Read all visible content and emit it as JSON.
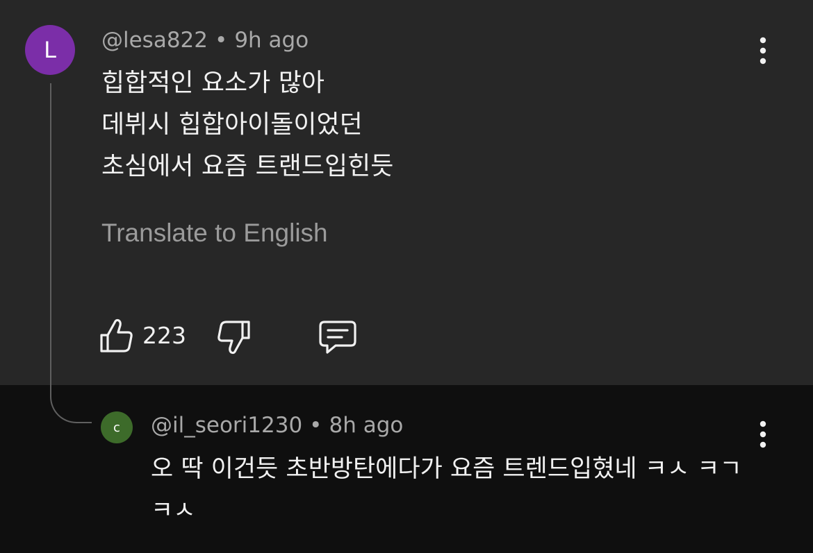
{
  "comment": {
    "avatar_letter": "L",
    "avatar_color": "#7b2ea8",
    "handle": "@lesa822",
    "separator": "•",
    "time": "9h ago",
    "lines": [
      "힙합적인 요소가 많아",
      "데뷔시 힙합아이돌이었던",
      "초심에서 요즘 트랜드입힌듯"
    ],
    "translate_label": "Translate to English",
    "like_count": "223",
    "icons": {
      "like": "thumbs-up-icon",
      "dislike": "thumbs-down-icon",
      "reply": "reply-comment-icon",
      "more": "more-vertical-icon"
    }
  },
  "reply": {
    "avatar_letter": "c",
    "avatar_color": "#3d6b2a",
    "handle": "@il_seori1230",
    "separator": "•",
    "time": "8h ago",
    "text": "오 딱 이건듯 초반방탄에다가 요즘 트렌드입혔네 ㅋㅅ ㅋㄱㅋㅅ"
  },
  "colors": {
    "top_background": "#272727",
    "bottom_background": "#0f0f0f",
    "meta_text": "#a9a9a9",
    "body_text": "#f1f1f1"
  }
}
